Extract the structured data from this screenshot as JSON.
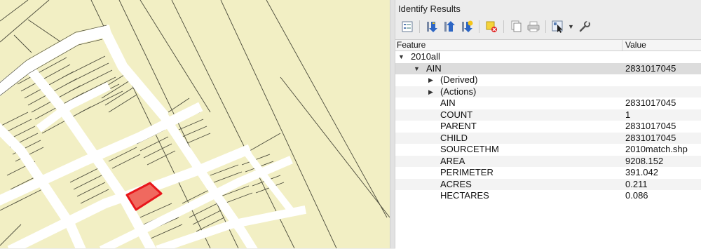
{
  "panel": {
    "title": "Identify Results"
  },
  "toolbar": {
    "icons": [
      "form-view-icon",
      "expand-tree-icon",
      "collapse-tree-icon",
      "expand-new-icon",
      "clear-results-icon",
      "copy-feature-icon",
      "print-icon",
      "identify-mode-icon",
      "settings-icon"
    ]
  },
  "table": {
    "headers": {
      "feature": "Feature",
      "value": "Value"
    },
    "layer": "2010all",
    "feature": {
      "name": "AIN",
      "value": "2831017045"
    },
    "groups": [
      "(Derived)",
      "(Actions)"
    ],
    "attributes": [
      {
        "name": "AIN",
        "value": "2831017045"
      },
      {
        "name": "COUNT",
        "value": "1"
      },
      {
        "name": "PARENT",
        "value": "2831017045"
      },
      {
        "name": "CHILD",
        "value": "2831017045"
      },
      {
        "name": "SOURCETHM",
        "value": "2010match.shp"
      },
      {
        "name": "AREA",
        "value": "9208.152"
      },
      {
        "name": "PERIMETER",
        "value": "391.042"
      },
      {
        "name": "ACRES",
        "value": "0.211"
      },
      {
        "name": "HECTARES",
        "value": "0.086"
      }
    ]
  },
  "colors": {
    "map_background": "#f2efc4",
    "road": "#ffffff",
    "parcel_line": "#4a4a3a",
    "highlight_fill": "#f0695f",
    "highlight_stroke": "#e8161b"
  }
}
